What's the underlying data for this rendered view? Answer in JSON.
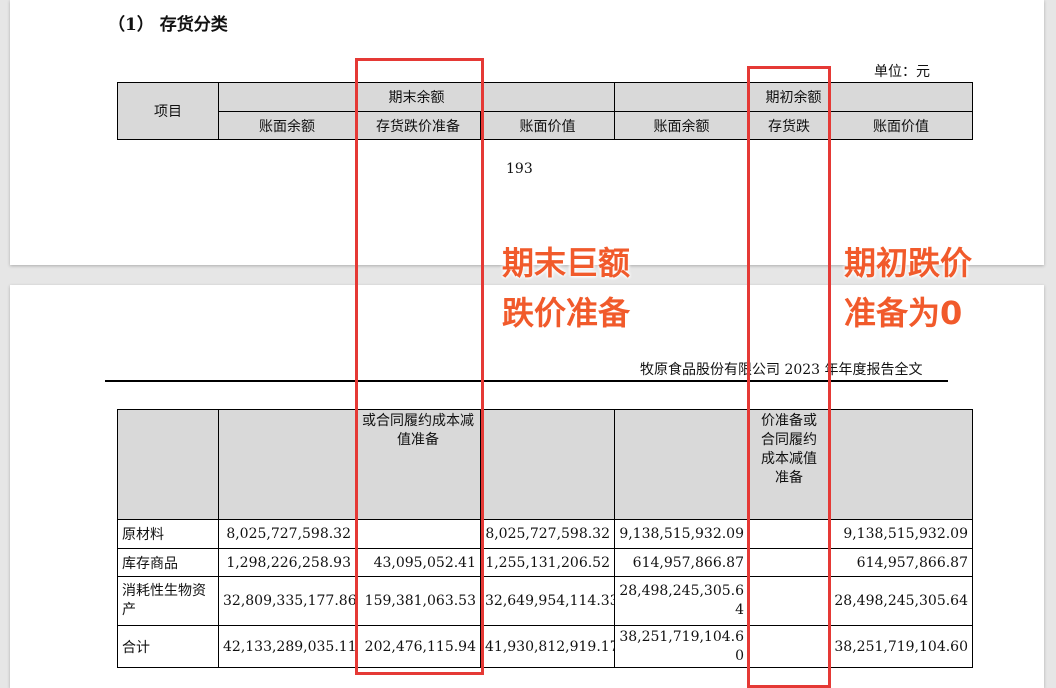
{
  "section_title": "（1）  存货分类",
  "unit_label": "单位：元",
  "page_number": "193",
  "company_header": "牧原食品股份有限公司 2023 年年度报告全文",
  "table_header": {
    "item": "项目",
    "ending_balance": "期末余额",
    "opening_balance": "期初余额",
    "sub": {
      "book_balance_1": "账面余额",
      "impairment_1_line1": "存货跌价准备",
      "impairment_1_line2": "或合同履约成本减值准备",
      "book_value_1": "账面价值",
      "book_balance_2": "账面余额",
      "impairment_2_line1": "存货跌",
      "impairment_2_line2": "价准备或合同履约成本减值准备",
      "book_value_2": "账面价值"
    }
  },
  "rows": [
    {
      "item": "原材料",
      "end_book_balance": "8,025,727,598.32",
      "end_impairment": "",
      "end_book_value": "8,025,727,598.32",
      "open_book_balance": "9,138,515,932.09",
      "open_impairment": "",
      "open_book_value": "9,138,515,932.09"
    },
    {
      "item": "库存商品",
      "end_book_balance": "1,298,226,258.93",
      "end_impairment": "43,095,052.41",
      "end_book_value": "1,255,131,206.52",
      "open_book_balance": "614,957,866.87",
      "open_impairment": "",
      "open_book_value": "614,957,866.87"
    },
    {
      "item": "消耗性生物资产",
      "end_book_balance": "32,809,335,177.86",
      "end_impairment": "159,381,063.53",
      "end_book_value": "32,649,954,114.33",
      "open_book_balance": "28,498,245,305.64",
      "open_impairment": "",
      "open_book_value": "28,498,245,305.64"
    },
    {
      "item": "合计",
      "end_book_balance": "42,133,289,035.11",
      "end_impairment": "202,476,115.94",
      "end_book_value": "41,930,812,919.17",
      "open_book_balance": "38,251,719,104.60",
      "open_impairment": "",
      "open_book_value": "38,251,719,104.60"
    }
  ],
  "annotations": {
    "left_line1": "期末巨额",
    "left_line2": "跌价准备",
    "right_line1": "期初跌价",
    "right_line2": "准备为0",
    "color": "#e53935"
  }
}
